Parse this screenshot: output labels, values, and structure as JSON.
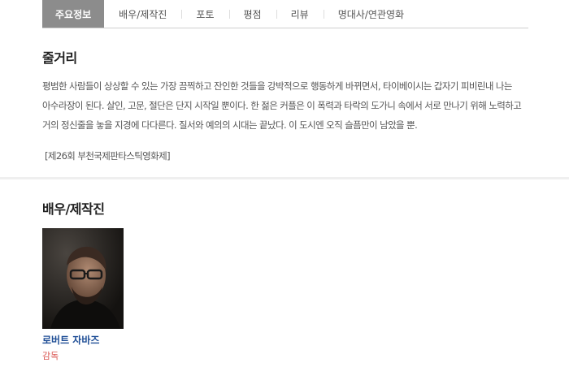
{
  "tabs": [
    {
      "label": "주요정보",
      "active": true
    },
    {
      "label": "배우/제작진",
      "active": false
    },
    {
      "label": "포토",
      "active": false
    },
    {
      "label": "평점",
      "active": false
    },
    {
      "label": "리뷰",
      "active": false
    },
    {
      "label": "명대사/연관영화",
      "active": false
    }
  ],
  "synopsis": {
    "title": "줄거리",
    "text": "평범한 사람들이 상상할 수 있는 가장 끔찍하고 잔인한 것들을 강박적으로 행동하게 바뀌면서, 타이베이시는 갑자기 피비린내 나는 아수라장이 된다. 살인, 고문, 절단은 단지 시작일 뿐이다. 한 젊은 커플은 이 폭력과 타락의 도가니 속에서 서로 만나기 위해 노력하고 거의 정신줄을 놓을 지경에 다다른다. 질서와 예의의 시대는 끝났다. 이 도시엔 오직 슬픔만이 남았을 뿐.",
    "festival": "[제26회 부천국제판타스틱영화제]"
  },
  "cast": {
    "title": "배우/제작진",
    "members": [
      {
        "name": "로버트 자바즈",
        "role": "감독"
      }
    ]
  },
  "colors": {
    "active_tab_bg": "#8c8c8c",
    "name_link": "#1f4e96",
    "role_text": "#d9534f"
  }
}
